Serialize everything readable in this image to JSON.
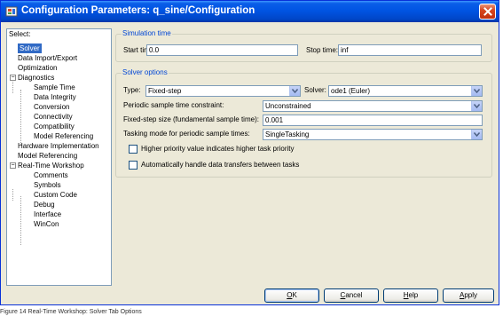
{
  "window": {
    "title": "Configuration Parameters: q_sine/Configuration",
    "colors": {
      "titlebar": "#0054e3",
      "face": "#ece9d8",
      "group_title": "#0046d5",
      "selection": "#316ac5"
    }
  },
  "tree": {
    "header": "Select:",
    "items": [
      {
        "label": "Solver",
        "selected": true
      },
      {
        "label": "Data Import/Export"
      },
      {
        "label": "Optimization"
      },
      {
        "label": "Diagnostics",
        "expander": "−"
      },
      {
        "label": "Sample Time"
      },
      {
        "label": "Data Integrity"
      },
      {
        "label": "Conversion"
      },
      {
        "label": "Connectivity"
      },
      {
        "label": "Compatibility"
      },
      {
        "label": "Model Referencing"
      },
      {
        "label": "Hardware Implementation"
      },
      {
        "label": "Model Referencing"
      },
      {
        "label": "Real-Time Workshop",
        "expander": "−"
      },
      {
        "label": "Comments"
      },
      {
        "label": "Symbols"
      },
      {
        "label": "Custom Code"
      },
      {
        "label": "Debug"
      },
      {
        "label": "Interface"
      },
      {
        "label": "WinCon"
      }
    ]
  },
  "simulation_time": {
    "title": "Simulation time",
    "start_label": "Start time:",
    "start_value": "0.0",
    "stop_label": "Stop time:",
    "stop_value": "inf"
  },
  "solver_options": {
    "title": "Solver options",
    "type_label": "Type:",
    "type_value": "Fixed-step",
    "solver_label": "Solver:",
    "solver_value": "ode1 (Euler)",
    "periodic_label": "Periodic sample time constraint:",
    "periodic_value": "Unconstrained",
    "fixed_step_label": "Fixed-step size (fundamental sample time):",
    "fixed_step_value": "0.001",
    "tasking_label": "Tasking mode for periodic sample times:",
    "tasking_value": "SingleTasking",
    "priority_label": "Higher priority value indicates higher task priority",
    "priority_checked": false,
    "transfers_label": "Automatically handle data transfers between tasks",
    "transfers_checked": false
  },
  "buttons": {
    "ok": {
      "pre": "",
      "u": "O",
      "post": "K"
    },
    "cancel": {
      "pre": "",
      "u": "C",
      "post": "ancel"
    },
    "help": {
      "pre": "",
      "u": "H",
      "post": "elp"
    },
    "apply": {
      "pre": "",
      "u": "A",
      "post": "pply"
    }
  },
  "caption": "Figure 14 Real-Time Workshop: Solver Tab Options"
}
